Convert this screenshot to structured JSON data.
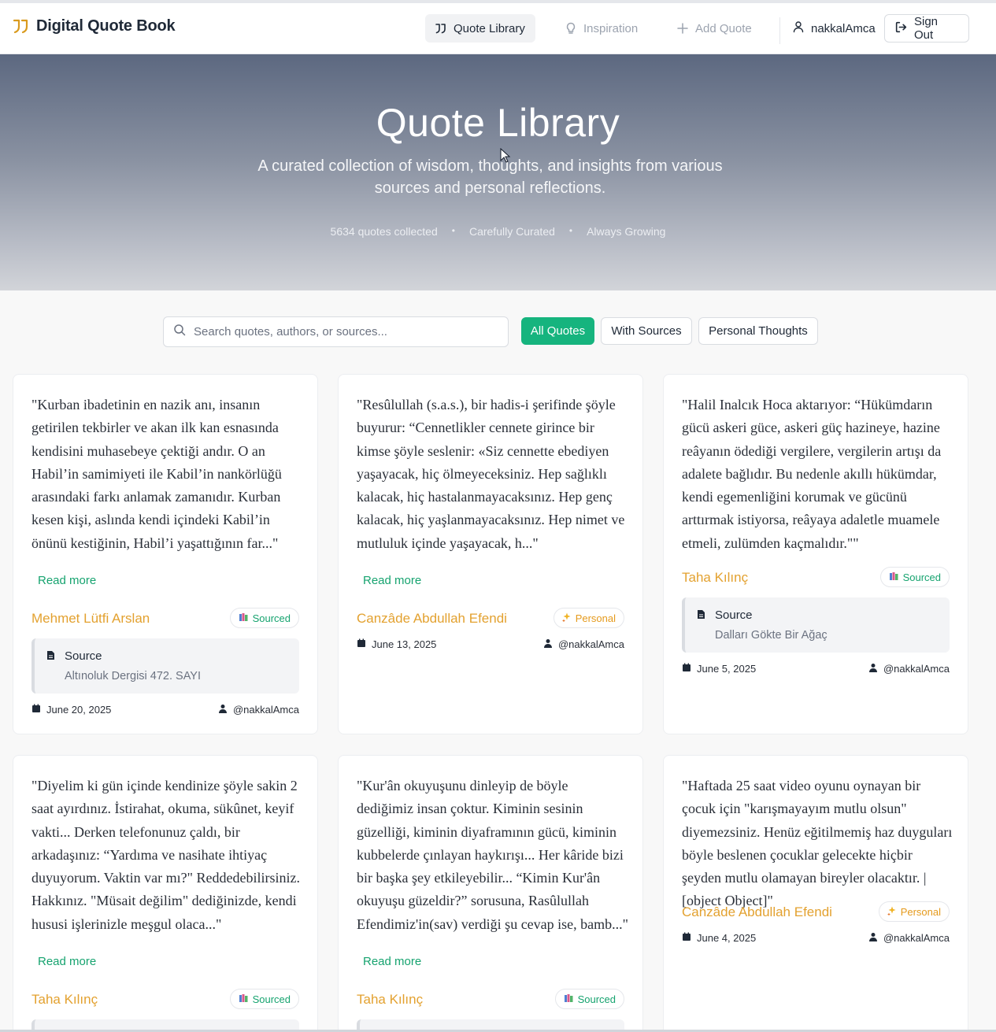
{
  "app": {
    "brand": "Digital Quote Book"
  },
  "nav": {
    "items": [
      {
        "label": "Quote Library",
        "icon": "quote-icon",
        "active": true
      },
      {
        "label": "Inspiration",
        "icon": "lightbulb-icon",
        "active": false
      },
      {
        "label": "Add Quote",
        "icon": "plus-icon",
        "active": false
      }
    ],
    "username": "nakkalAmca",
    "signout_label": "Sign Out"
  },
  "hero": {
    "title": "Quote Library",
    "subtitle": "A curated collection of wisdom, thoughts, and insights from various sources and personal reflections.",
    "stats": [
      "5634 quotes collected",
      "Carefully Curated",
      "Always Growing"
    ]
  },
  "search": {
    "placeholder": "Search quotes, authors, or sources..."
  },
  "filters": [
    {
      "label": "All Quotes",
      "active": true
    },
    {
      "label": "With Sources",
      "active": false
    },
    {
      "label": "Personal Thoughts",
      "active": false
    }
  ],
  "read_more_label": "Read more",
  "source_label": "Source",
  "colors": {
    "accent_green": "#16b47e",
    "author_orange": "#e3a12f",
    "brand_icon": "#d99a1e"
  },
  "cards": [
    {
      "quote": "\"Kurban ibadetinin en nazik anı, insanın getirilen tekbirler ve akan ilk kan esnasında kendisini muhasebeye çektiği andır. O an Habil’in samimiyeti ile Kabil’in nankörlüğü arasındaki farkı anlamak zamanıdır. Kurban kesen kişi, aslında kendi içindeki Kabil’in önünü kestiğinin, Habil’i yaşattığının far...\"",
      "read_more": true,
      "author": "Mehmet Lütfi Arslan",
      "badge": "Sourced",
      "source": "Altınoluk Dergisi 472. SAYI",
      "date": "June 20, 2025",
      "user": "@nakkalAmca"
    },
    {
      "quote": "\"Resûlullah (s.a.s.), bir hadis-i şerifinde şöyle buyurur: “Cennetlikler cennete girince bir kimse şöyle seslenir: «Siz cennette ebediyen yaşayacak, hiç ölmeyeceksiniz. Hep sağlıklı kalacak, hiç hastalanmayacaksınız. Hep genç kalacak, hiç yaşlanmayacaksınız. Hep nimet ve mutluluk içinde yaşayacak, h...\"",
      "read_more": true,
      "author": "Canzâde Abdullah Efendi",
      "badge": "Personal",
      "source": null,
      "date": "June 13, 2025",
      "user": "@nakkalAmca"
    },
    {
      "quote": "\"Halil Inalcık Hoca aktarıyor: “Hükümdarın gücü askeri güce, askeri güç hazineye, hazine reâyanın ödediği vergilere, vergilerin artışı da adalete bağlıdır. Bu nedenle akıllı hükümdar, kendi egemenliğini korumak ve gücünü arttırmak istiyorsa, reâyaya adaletle muamele etmeli, zulümden kaçmalıdır.\"\"",
      "read_more": false,
      "author": "Taha Kılınç",
      "badge": "Sourced",
      "source": "Dalları Gökte Bir Ağaç",
      "date": "June 5, 2025",
      "user": "@nakkalAmca"
    },
    {
      "quote": "\"Diyelim ki gün içinde kendinize şöyle sakin 2 saat ayırdınız. İstirahat, okuma, sükûnet, keyif vakti... Derken telefonunuz çaldı, bir arkadaşınız: “Yardıma ve nasihate ihtiyaç duyuyorum. Vaktin var mı?\" Reddedebilirsiniz. Hakkınız. \"Müsait değilim\" dediğinizde, kendi hususi işlerinizle meşgul olaca...\"",
      "read_more": true,
      "author": "Taha Kılınç",
      "badge": "Sourced",
      "source": null,
      "date": null,
      "user": null
    },
    {
      "quote": "\"Kur'ân okuyuşunu dinleyip de böyle dediğimiz insan çoktur. Kiminin sesinin güzelliği, kiminin diyaframının gücü, kiminin kubbelerde çınlayan haykırışı... Her kâride bizi bir başka şey etkileyebilir... “Kimin Kur'ân okuyuşu güzeldir?” sorusuna, Rasûlullah Efendimiz'in(sav) verdiği şu cevap ise, bamb...\"",
      "read_more": true,
      "author": "Taha Kılınç",
      "badge": "Sourced",
      "source": null,
      "date": null,
      "user": null
    },
    {
      "quote": "\"Haftada 25 saat video oyunu oynayan bir çocuk için \"karışmayayım mutlu olsun\" diyemezsiniz. Henüz eğitilmemiş haz duyguları böyle beslenen çocuklar gelecekte hiçbir şeyden mutlu olamayan bireyler olacaktır. | [object Object]\"",
      "read_more": false,
      "author": "Canzâde Abdullah Efendi",
      "badge": "Personal",
      "source": null,
      "date": "June 4, 2025",
      "user": "@nakkalAmca"
    }
  ]
}
